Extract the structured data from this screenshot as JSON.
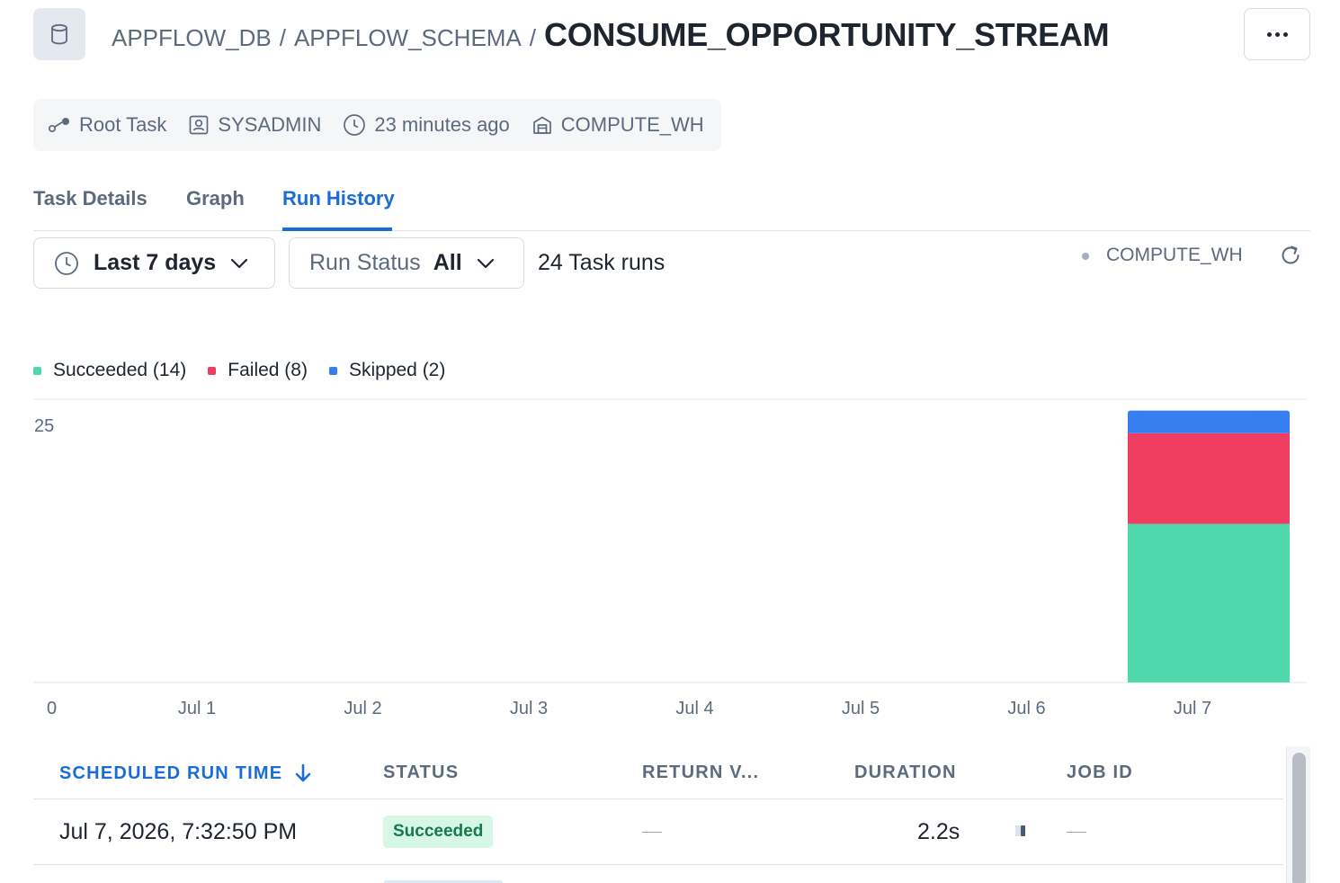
{
  "header": {
    "database": "APPFLOW_DB",
    "schema": "APPFLOW_SCHEMA",
    "task_name": "CONSUME_OPPORTUNITY_STREAM",
    "separator": "/"
  },
  "meta": {
    "task_type": "Root Task",
    "owner": "SYSADMIN",
    "last_modified": "23 minutes ago",
    "warehouse": "COMPUTE_WH"
  },
  "tabs": [
    {
      "label": "Task Details",
      "active": false
    },
    {
      "label": "Graph",
      "active": false
    },
    {
      "label": "Run History",
      "active": true
    }
  ],
  "filters": {
    "time_range": "Last 7 days",
    "run_status_label": "Run Status",
    "run_status_value": "All",
    "run_count": "24 Task runs"
  },
  "warehouse_indicator": "COMPUTE_WH",
  "legend": [
    {
      "label": "Succeeded (14)",
      "color": "#4fd8ab"
    },
    {
      "label": "Failed (8)",
      "color": "#ef3e5f"
    },
    {
      "label": "Skipped (2)",
      "color": "#377ff0"
    }
  ],
  "chart_data": {
    "type": "bar",
    "stacked": true,
    "categories": [
      "Jul 1",
      "Jul 2",
      "Jul 3",
      "Jul 4",
      "Jul 5",
      "Jul 6",
      "Jul 7"
    ],
    "series": [
      {
        "name": "Succeeded",
        "color": "#4fd8ab",
        "values": [
          0,
          0,
          0,
          0,
          0,
          0,
          14
        ]
      },
      {
        "name": "Failed",
        "color": "#ef3e5f",
        "values": [
          0,
          0,
          0,
          0,
          0,
          0,
          8
        ]
      },
      {
        "name": "Skipped",
        "color": "#377ff0",
        "values": [
          0,
          0,
          0,
          0,
          0,
          0,
          2
        ]
      }
    ],
    "y_ticks": [
      "25",
      "0"
    ],
    "ylim": [
      0,
      25
    ],
    "legend_position": "top-left",
    "grid": false
  },
  "table": {
    "columns": [
      "SCHEDULED RUN TIME",
      "STATUS",
      "RETURN V...",
      "DURATION",
      "JOB ID"
    ],
    "sort_column": "SCHEDULED RUN TIME",
    "sort_direction": "descending",
    "rows": [
      {
        "run_time": "Jul 7, 2026, 7:32:50 PM",
        "status": "Succeeded",
        "return_value": "—",
        "duration": "2.2s",
        "job_id": "—"
      }
    ]
  }
}
